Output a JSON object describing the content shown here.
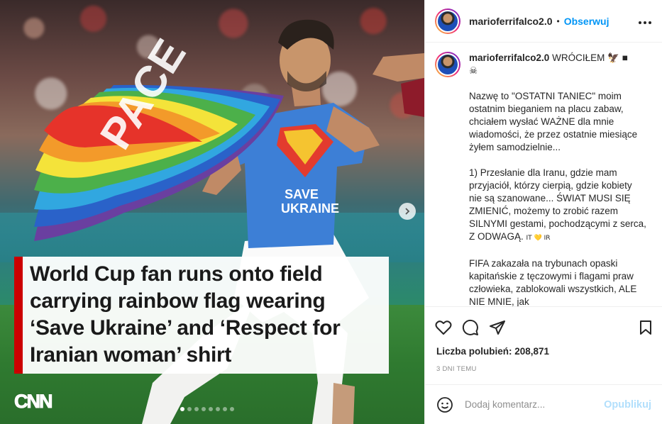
{
  "post": {
    "image": {
      "headline": "World Cup fan runs onto field carrying rainbow flag wearing ‘Save Ukraine’ and ‘Respect for Iranian woman’ shirt",
      "logo_text": "CNN",
      "shirt_text_line1": "SAVE",
      "shirt_text_line2": "UKRAINE",
      "flag_text": "PACE",
      "carousel_dots": 8,
      "active_dot": 1,
      "next_icon": "chevron-right-icon"
    },
    "header": {
      "username": "marioferrifalco2.0",
      "separator": "•",
      "follow_label": "Obserwuj",
      "more_icon": "…"
    },
    "caption": {
      "username": "marioferrifalco2.0",
      "title": "WRÓCIŁEM",
      "title_emojis": "🦅 ■",
      "line2": "☠",
      "para1": "Nazwę to \"OSTATNI TANIEC\" moim ostatnim bieganiem na placu zabaw, chciałem wysłać WAŻNE dla mnie wiadomości, że przez ostatnie miesiące żyłem samodzielnie...",
      "para2": "1) Przesłanie dla Iranu, gdzie mam przyjaciół, którzy cierpią, gdzie kobiety nie są szanowane... ŚWIAT MUSI SIĘ ZMIENIĆ, możemy to zrobić razem SILNYMI gestami, pochodzącymi z serca, Z ODWAGĄ.",
      "para2_flags": "IT 💛 IR",
      "para3": "FIFA zakazała na trybunach opaski kapitańskie z tęczowymi i flagami praw człowieka, zablokowali wszystkich, ALE NIE MNIE, jak"
    },
    "likes": "Liczba polubień: 208,871",
    "timestamp": "3 DNI TEMU",
    "comment": {
      "placeholder": "Dodaj komentarz...",
      "publish_label": "Opublikuj"
    },
    "colors": {
      "accent": "#0095f6",
      "publish_disabled": "#b2dffc",
      "cnn_red": "#cc0000"
    }
  }
}
